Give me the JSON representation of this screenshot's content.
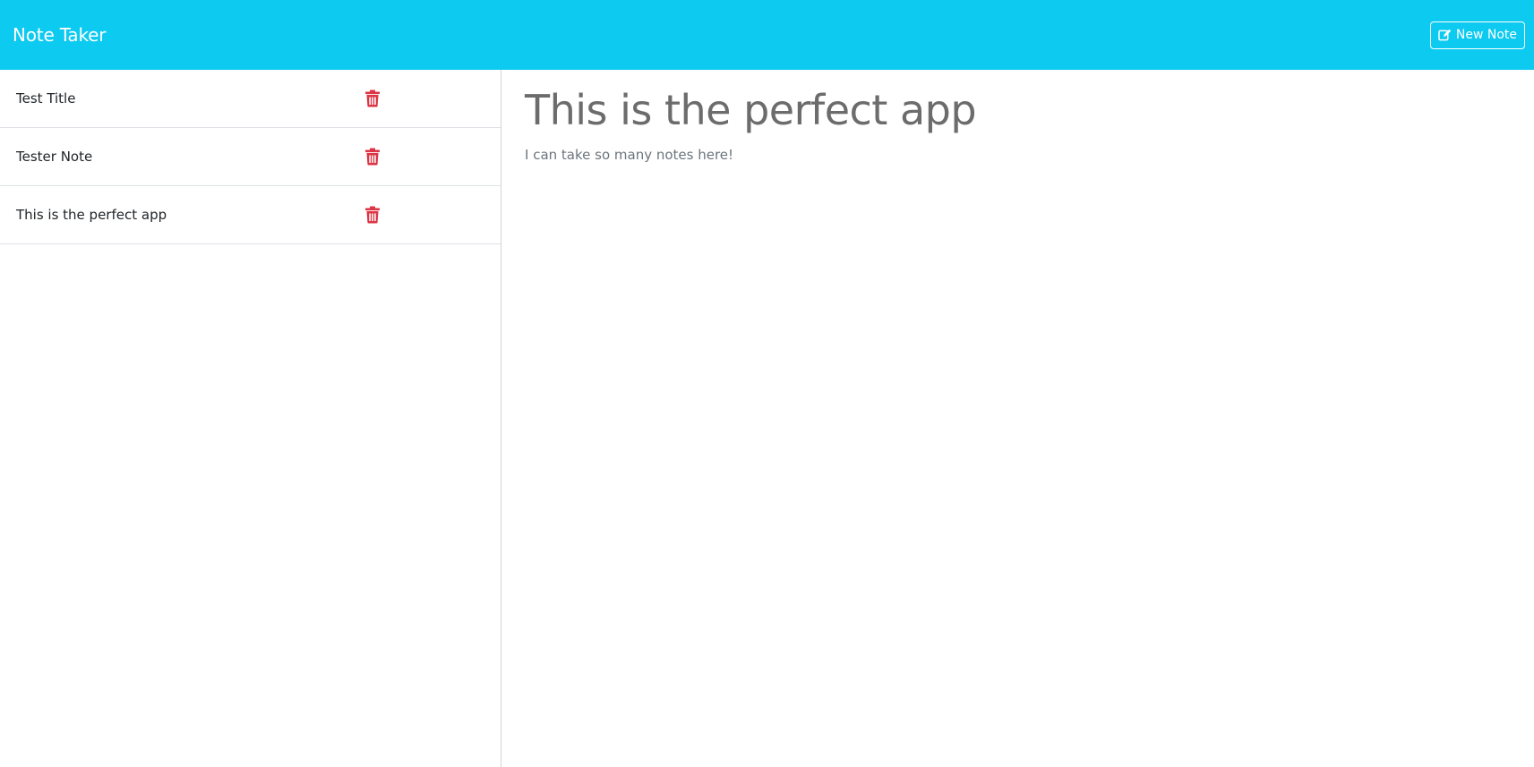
{
  "header": {
    "brand": "Note Taker",
    "new_note_label": "New Note",
    "new_note_icon": "edit-icon",
    "background_color": "#0dcaf0"
  },
  "sidebar": {
    "notes": [
      {
        "title": "Test Title",
        "delete_icon": "trash-icon"
      },
      {
        "title": "Tester Note",
        "delete_icon": "trash-icon"
      },
      {
        "title": "This is the perfect app",
        "delete_icon": "trash-icon"
      }
    ],
    "delete_color": "#dc3545"
  },
  "editor": {
    "title": "This is the perfect app",
    "body": "I can take so many notes here!"
  }
}
